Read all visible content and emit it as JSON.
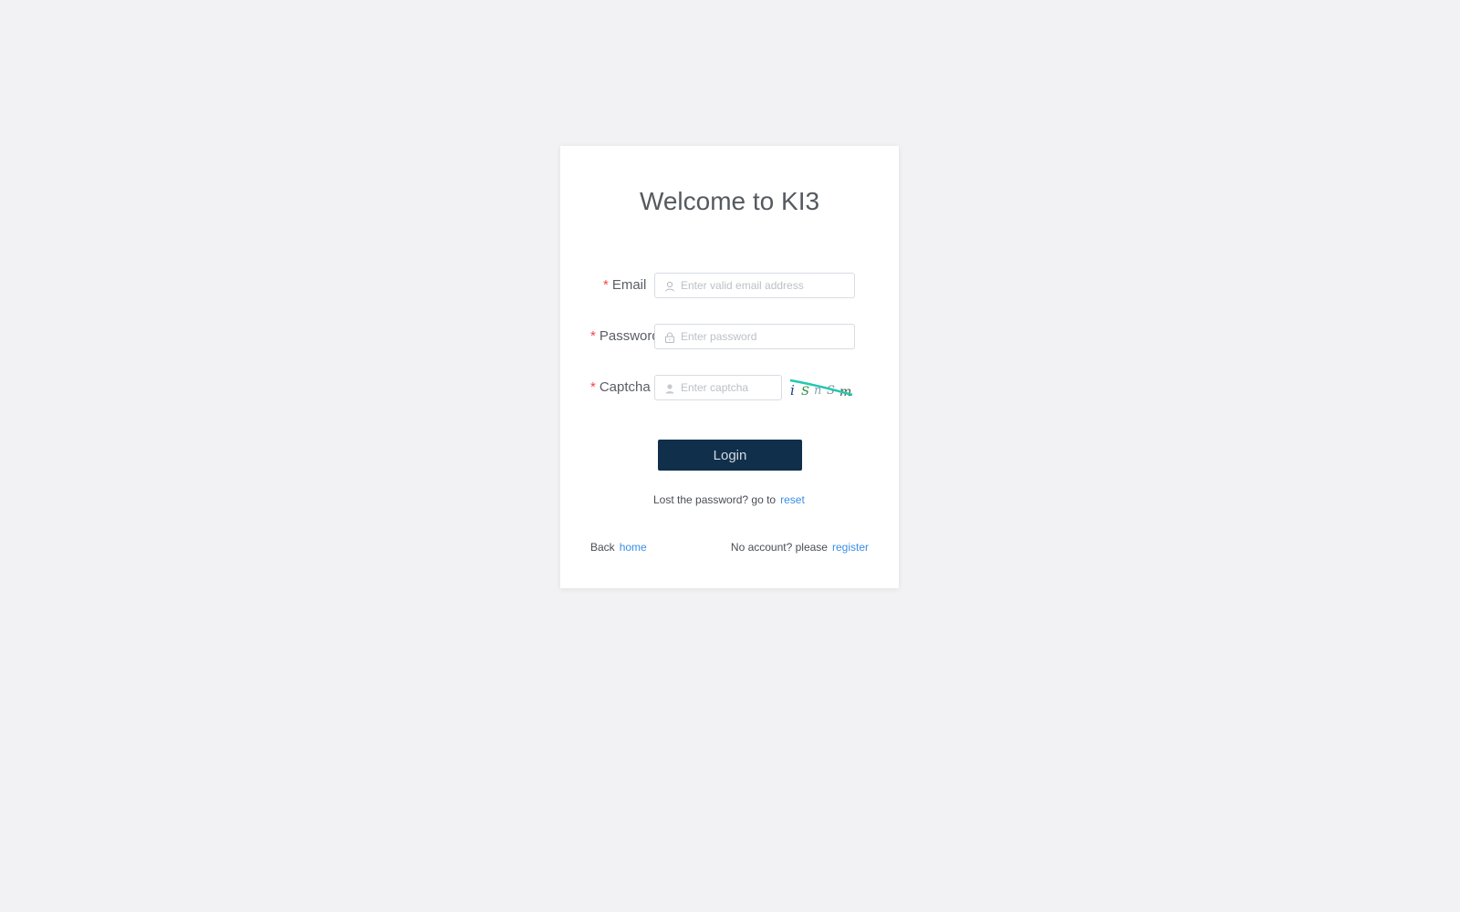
{
  "login": {
    "title": "Welcome to KI3",
    "required_mark": "*",
    "email": {
      "label": "Email",
      "placeholder": "Enter valid email address",
      "icon": "user-icon"
    },
    "password": {
      "label": "Password",
      "placeholder": "Enter password",
      "icon": "lock-icon"
    },
    "captcha": {
      "label": "Captcha",
      "placeholder": "Enter captcha",
      "icon": "user-icon",
      "code": "iSnSm"
    },
    "login_button": "Login",
    "reset_prompt": "Lost the password? go to",
    "reset_link": "reset",
    "back_prompt": "Back",
    "home_link": "home",
    "register_prompt": "No account? please",
    "register_link": "register"
  },
  "colors": {
    "background": "#f2f2f4",
    "button": "#102f4a",
    "link": "#3a8ee6",
    "required": "#f5464b"
  }
}
